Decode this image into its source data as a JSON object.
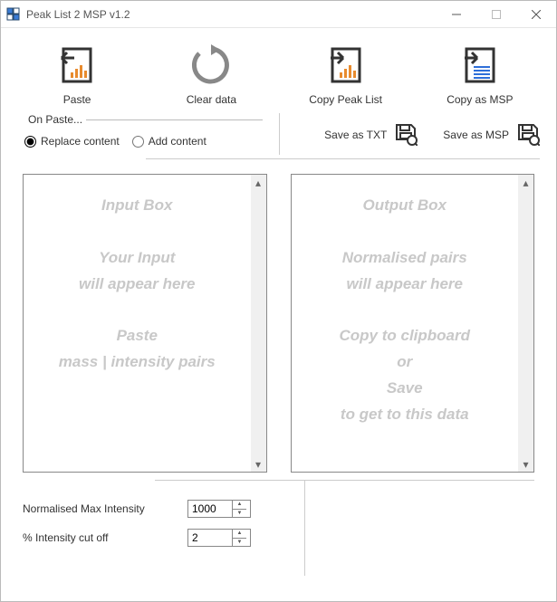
{
  "window": {
    "title": "Peak List 2 MSP v1.2"
  },
  "toolbar": {
    "paste": "Paste",
    "clear": "Clear data",
    "copy_peak": "Copy Peak List",
    "copy_msp": "Copy as MSP"
  },
  "on_paste": {
    "legend": "On Paste...",
    "replace": "Replace content",
    "add": "Add content",
    "selected": "replace"
  },
  "save": {
    "txt": "Save as TXT",
    "msp": "Save as MSP"
  },
  "input_box_placeholder": "Input Box\n\nYour Input\nwill appear here\n\nPaste\nmass | intensity pairs",
  "output_box_placeholder": "Output  Box\n\nNormalised pairs\nwill appear here\n\nCopy to clipboard\nor\nSave\nto get to this data",
  "params": {
    "norm_label": "Normalised Max Intensity",
    "norm_value": "1000",
    "cutoff_label": "% Intensity cut off",
    "cutoff_value": "2"
  }
}
